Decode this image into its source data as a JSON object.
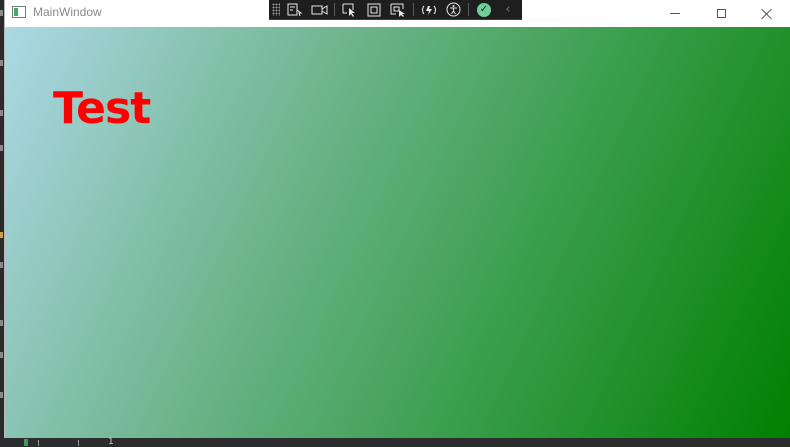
{
  "window": {
    "title": "MainWindow",
    "buttons": {
      "minimize": "minimize-icon",
      "maximize": "maximize-icon",
      "close": "close-icon"
    }
  },
  "debug_toolbar": {
    "icons": [
      "grip-icon",
      "live-visual-tree-icon",
      "record-icon",
      "select-element-icon",
      "display-layout-adorners-icon",
      "track-focus-icon",
      "hot-reload-icon",
      "accessibility-icon",
      "binding-check-icon",
      "collapse-chevron-icon"
    ]
  },
  "content": {
    "label": "Test",
    "label_color": "#ff0000",
    "gradient_start": "#add8e6",
    "gradient_end": "#008000"
  },
  "status_bar": {
    "line_number": "1"
  }
}
